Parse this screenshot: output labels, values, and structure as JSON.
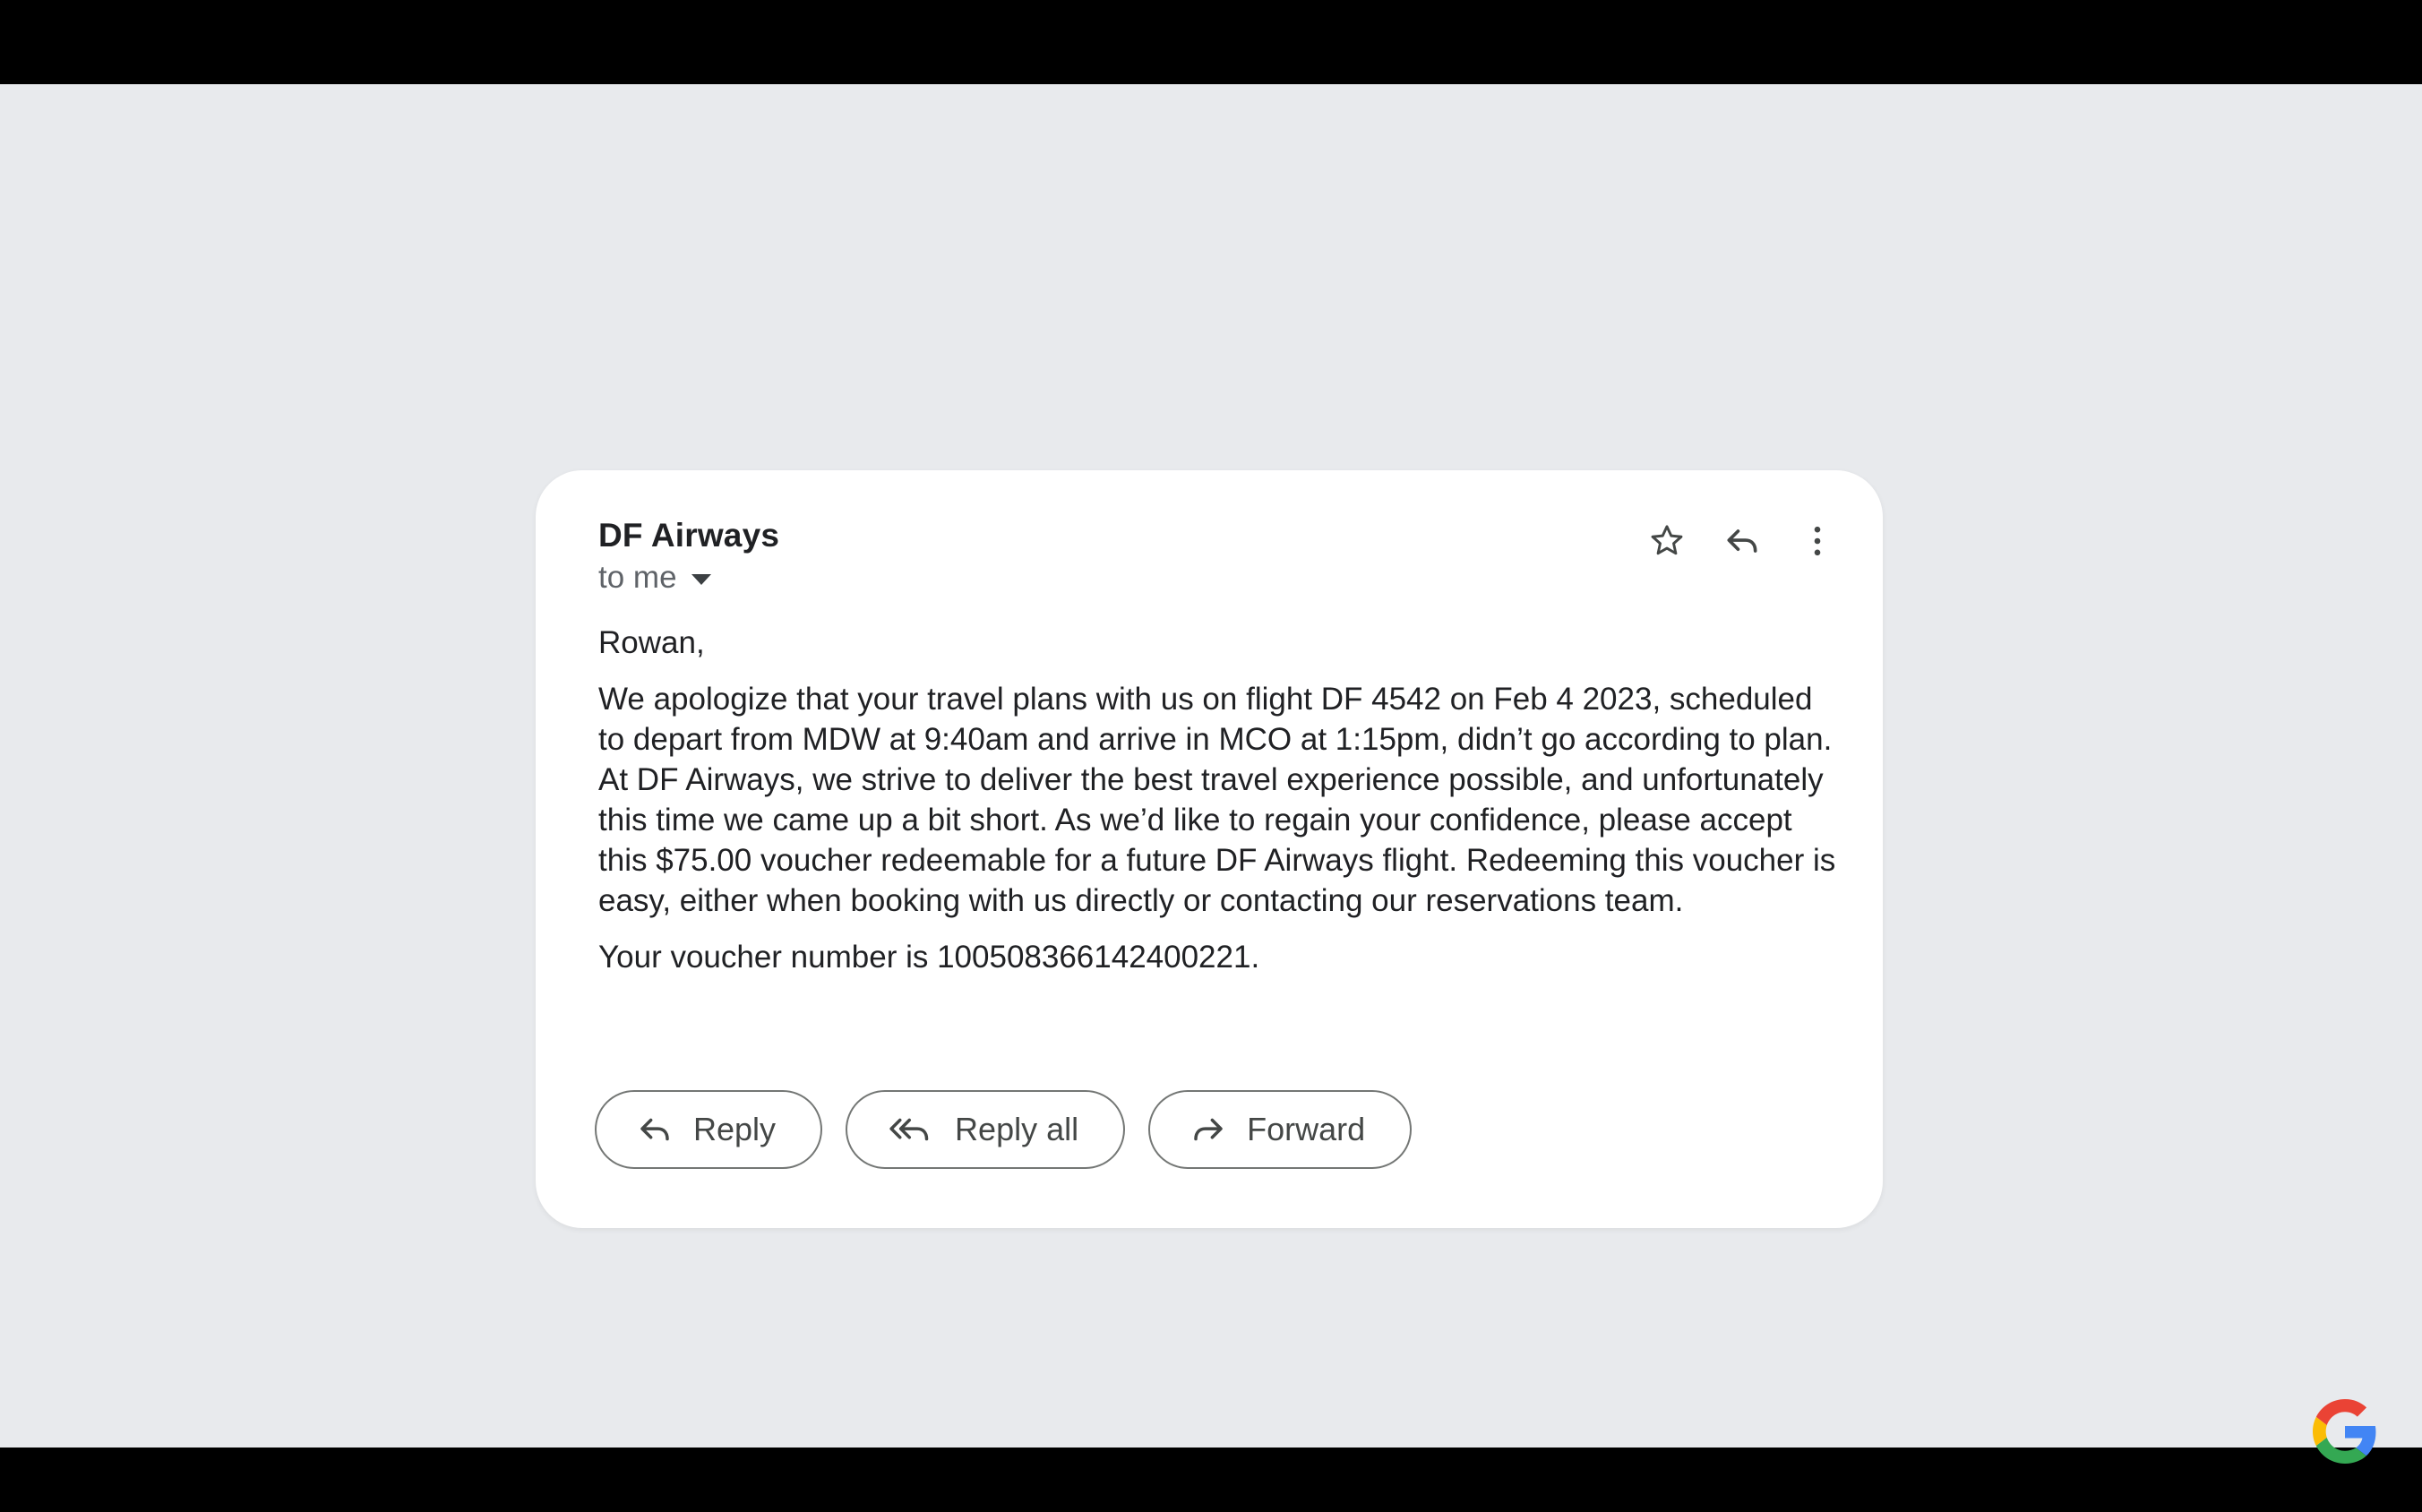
{
  "email": {
    "sender": "DF Airways",
    "recipient": "to me",
    "greeting": "Rowan,",
    "paragraph": "We apologize that your travel plans with us on flight DF 4542 on Feb 4 2023, scheduled to depart from MDW at 9:40am and arrive in MCO at 1:15pm, didn’t go according to plan. At DF Airways, we strive to deliver the best travel experience possible, and unfortunately this time we came up a bit short. As we’d like to regain your confidence, please accept this $75.00 voucher redeemable for a future DF Airways flight. Redeeming this voucher is easy, either when booking with us directly or contacting our reservations team.",
    "voucher_line": "Your voucher number is 100508366142400221."
  },
  "header_icons": [
    "star-icon",
    "reply-icon",
    "more-vert-icon"
  ],
  "actions": {
    "reply_label": "Reply",
    "reply_all_label": "Reply all",
    "forward_label": "Forward"
  },
  "colors": {
    "background": "#e8eaed",
    "card": "#ffffff",
    "text": "#202124",
    "secondary_text": "#5f6368",
    "button_border": "#747775",
    "letterbox": "#000000"
  }
}
